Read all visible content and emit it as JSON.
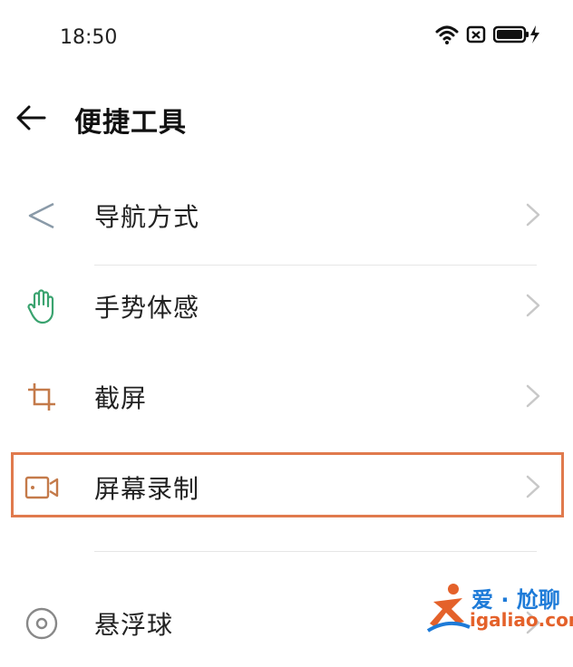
{
  "status_bar": {
    "time": "18:50"
  },
  "header": {
    "title": "便捷工具"
  },
  "items": [
    {
      "label": "导航方式",
      "icon": "navigation-icon"
    },
    {
      "label": "手势体感",
      "icon": "hand-gesture-icon"
    },
    {
      "label": "截屏",
      "icon": "crop-screenshot-icon"
    },
    {
      "label": "屏幕录制",
      "icon": "screen-record-icon"
    },
    {
      "label": "悬浮球",
      "icon": "floating-ball-icon"
    }
  ],
  "watermark": {
    "title": "爱 · 尬聊",
    "url": "igaliao.com"
  },
  "colors": {
    "highlight": "#e07a4d",
    "gesture_icon": "#3aa36f",
    "crop_icon": "#c47a4a",
    "record_icon": "#c47a4a",
    "nav_icon": "#8a9aa8",
    "float_icon": "#888888"
  }
}
